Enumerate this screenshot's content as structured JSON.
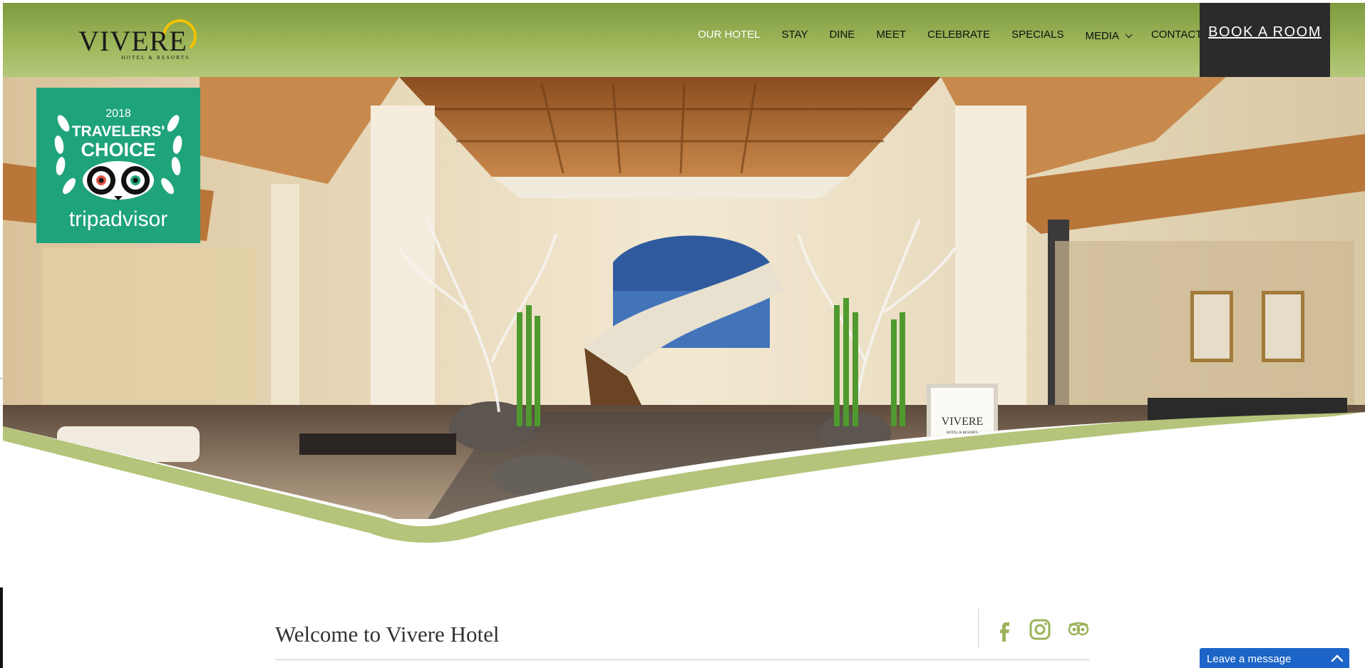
{
  "brand": {
    "logo_word": "VIVERE",
    "logo_sub": "HOTEL & RESORTS",
    "green": "#9bb35a",
    "dark": "#2b2b2b"
  },
  "nav": {
    "items": [
      {
        "label": "OUR HOTEL",
        "active": true
      },
      {
        "label": "STAY"
      },
      {
        "label": "DINE"
      },
      {
        "label": "MEET"
      },
      {
        "label": "CELEBRATE"
      },
      {
        "label": "SPECIALS"
      },
      {
        "label": "MEDIA",
        "has_dropdown": true
      },
      {
        "label": "CONTACT"
      }
    ],
    "book_label": "BOOK A ROOM"
  },
  "badge": {
    "year": "2018",
    "line1": "TRAVELERS'",
    "line2": "CHOICE",
    "brand": "tripadvisor"
  },
  "welcome": {
    "title": "Welcome to Vivere Hotel"
  },
  "social": {
    "icons": [
      "facebook-icon",
      "instagram-icon",
      "tripadvisor-icon"
    ]
  },
  "chat": {
    "label": "Leave a message"
  },
  "lobby_sign": {
    "text": "VIVERE",
    "sub": "HOTEL & RESORTS"
  }
}
